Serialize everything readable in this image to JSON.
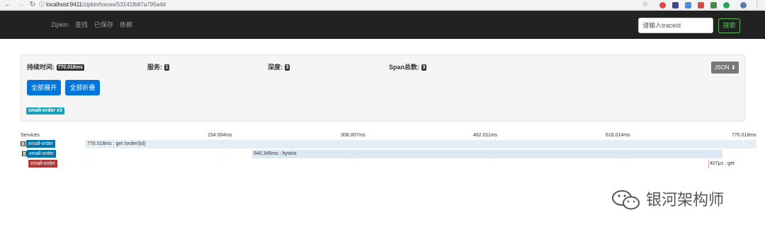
{
  "browser": {
    "url_host": "localhost:9411",
    "url_path": "/zipkin/traces/53141fb87a795a4d"
  },
  "navbar": {
    "brand": "Zipkin",
    "links": [
      "查找",
      "已保存",
      "依赖"
    ],
    "search_placeholder": "请输入traceid",
    "search_button": "搜索"
  },
  "summary": {
    "duration_label": "持续时间:",
    "duration_value": "770.018ms",
    "services_label": "服务:",
    "services_value": "1",
    "depth_label": "深度:",
    "depth_value": "3",
    "spans_label": "Span总数:",
    "spans_value": "3",
    "json_button": "JSON",
    "expand_all": "全部展开",
    "collapse_all": "全部折叠",
    "service_tag": "xmall-order x3"
  },
  "timeline": {
    "services_header": "Services",
    "ticks": [
      "154.004ms",
      "308.007ms",
      "462.011ms",
      "616.014ms",
      "770.018ms"
    ],
    "rows": [
      {
        "service": "xmall-order",
        "label": "770.018ms : get /order/{id}",
        "toggle": "⊟",
        "color": "#0275a8"
      },
      {
        "service": "xmall-order",
        "label": "540.345ms : hystrix",
        "toggle": "⊟",
        "color": "#0275a8"
      },
      {
        "service": "xmall-order",
        "label": "407μs : get",
        "toggle": "",
        "color": "#b03a3a"
      }
    ]
  },
  "watermark": {
    "text": "银河架构师"
  }
}
